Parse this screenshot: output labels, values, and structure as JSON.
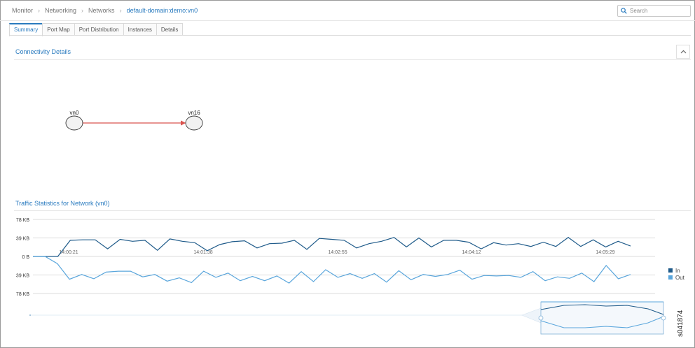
{
  "breadcrumb": [
    "Monitor",
    "Networking",
    "Networks",
    "default-domain:demo:vn0"
  ],
  "search": {
    "placeholder": "Search"
  },
  "tabs": [
    {
      "label": "Summary",
      "active": true
    },
    {
      "label": "Port Map",
      "active": false
    },
    {
      "label": "Port Distribution",
      "active": false
    },
    {
      "label": "Instances",
      "active": false
    },
    {
      "label": "Details",
      "active": false
    }
  ],
  "connectivity": {
    "title": "Connectivity Details",
    "nodes": [
      "vn0",
      "vn16"
    ],
    "link_color": "#d9534f"
  },
  "traffic": {
    "title": "Traffic Statistics for Network (vn0)"
  },
  "figure_id": "s041874",
  "colors": {
    "accent": "#2a7bbf",
    "in_series": "#1f5b8a",
    "out_series": "#5aa6dc"
  },
  "icons": {
    "search": "search-icon",
    "collapse": "chevron-up-icon"
  },
  "chart_data": {
    "type": "line",
    "title": "Traffic Statistics for Network (vn0)",
    "xlabel": "",
    "ylabel": "",
    "y_tick_labels": [
      "78 KB",
      "39 KB",
      "0 B",
      "39 KB",
      "78 KB"
    ],
    "y_ticks": [
      78,
      39,
      0,
      -39,
      -78
    ],
    "ylim": [
      -78,
      78
    ],
    "x_tick_labels": [
      "14:00:21",
      "14:01:38",
      "14:02:55",
      "14:04:12",
      "14:05:29"
    ],
    "legend": {
      "placement": "right",
      "entries": [
        "In",
        "Out"
      ]
    },
    "grid": true,
    "series": [
      {
        "name": "In",
        "color": "#1f5b8a",
        "values": [
          0,
          0,
          0,
          34,
          35,
          35,
          16,
          36,
          32,
          34,
          13,
          37,
          32,
          29,
          12,
          25,
          31,
          33,
          18,
          27,
          28,
          34,
          15,
          38,
          36,
          34,
          18,
          27,
          32,
          40,
          20,
          39,
          20,
          34,
          34,
          30,
          16,
          29,
          24,
          27,
          21,
          30,
          21,
          40,
          21,
          35,
          20,
          32,
          22
        ]
      },
      {
        "name": "Out",
        "color": "#5aa6dc",
        "values": [
          0,
          0,
          -15,
          -48,
          -38,
          -47,
          -33,
          -31,
          -31,
          -43,
          -38,
          -52,
          -45,
          -55,
          -31,
          -44,
          -35,
          -51,
          -42,
          -51,
          -41,
          -56,
          -32,
          -53,
          -28,
          -44,
          -36,
          -46,
          -36,
          -54,
          -30,
          -49,
          -38,
          -42,
          -38,
          -29,
          -48,
          -40,
          -41,
          -40,
          -44,
          -32,
          -51,
          -43,
          -46,
          -35,
          -53,
          -19,
          -47,
          -38
        ]
      }
    ]
  }
}
